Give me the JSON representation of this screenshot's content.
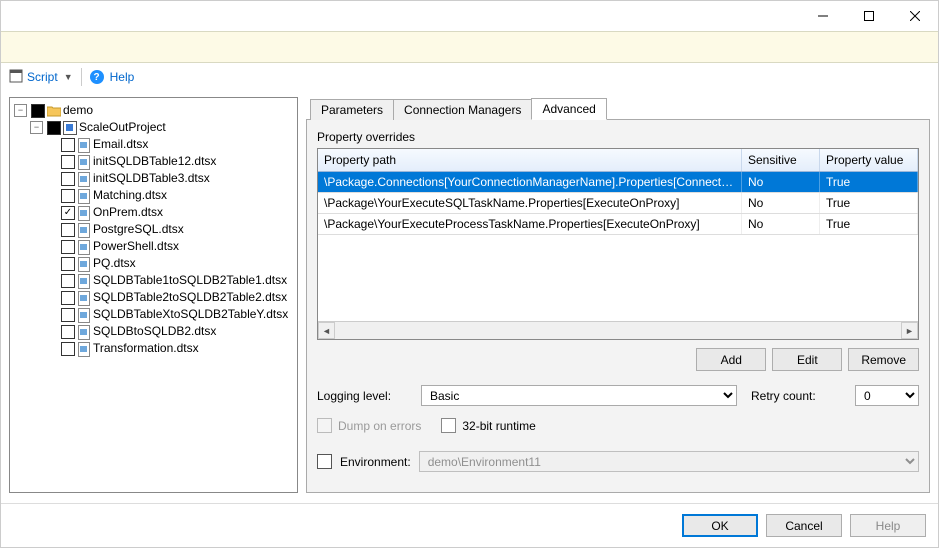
{
  "toolbar": {
    "script_label": "Script",
    "help_label": "Help"
  },
  "tree": {
    "root": {
      "label": "demo",
      "children": [
        {
          "label": "ScaleOutProject",
          "type": "project",
          "checked": "filled",
          "children": [
            {
              "label": "Email.dtsx",
              "checked": "none"
            },
            {
              "label": "initSQLDBTable12.dtsx",
              "checked": "none"
            },
            {
              "label": "initSQLDBTable3.dtsx",
              "checked": "none"
            },
            {
              "label": "Matching.dtsx",
              "checked": "none"
            },
            {
              "label": "OnPrem.dtsx",
              "checked": "check"
            },
            {
              "label": "PostgreSQL.dtsx",
              "checked": "none"
            },
            {
              "label": "PowerShell.dtsx",
              "checked": "none"
            },
            {
              "label": "PQ.dtsx",
              "checked": "none"
            },
            {
              "label": "SQLDBTable1toSQLDB2Table1.dtsx",
              "checked": "none"
            },
            {
              "label": "SQLDBTable2toSQLDB2Table2.dtsx",
              "checked": "none"
            },
            {
              "label": "SQLDBTableXtoSQLDB2TableY.dtsx",
              "checked": "none"
            },
            {
              "label": "SQLDBtoSQLDB2.dtsx",
              "checked": "none"
            },
            {
              "label": "Transformation.dtsx",
              "checked": "none"
            }
          ]
        }
      ]
    }
  },
  "tabs": {
    "parameters": "Parameters",
    "conn_mgr": "Connection Managers",
    "advanced": "Advanced"
  },
  "overrides": {
    "section_label": "Property overrides",
    "columns": {
      "path": "Property path",
      "sensitive": "Sensitive",
      "value": "Property value"
    },
    "rows": [
      {
        "path": "\\Package.Connections[YourConnectionManagerName].Properties[ConnectByProxy]",
        "sensitive": "No",
        "value": "True",
        "selected": true
      },
      {
        "path": "\\Package\\YourExecuteSQLTaskName.Properties[ExecuteOnProxy]",
        "sensitive": "No",
        "value": "True",
        "selected": false
      },
      {
        "path": "\\Package\\YourExecuteProcessTaskName.Properties[ExecuteOnProxy]",
        "sensitive": "No",
        "value": "True",
        "selected": false
      }
    ]
  },
  "buttons": {
    "add": "Add",
    "edit": "Edit",
    "remove": "Remove"
  },
  "logging": {
    "label": "Logging level:",
    "value": "Basic"
  },
  "retry": {
    "label": "Retry count:",
    "value": "0"
  },
  "checks": {
    "dump": "Dump on errors",
    "runtime32": "32-bit runtime"
  },
  "environment": {
    "label": "Environment:",
    "value": "demo\\Environment11"
  },
  "footer": {
    "ok": "OK",
    "cancel": "Cancel",
    "help": "Help"
  }
}
